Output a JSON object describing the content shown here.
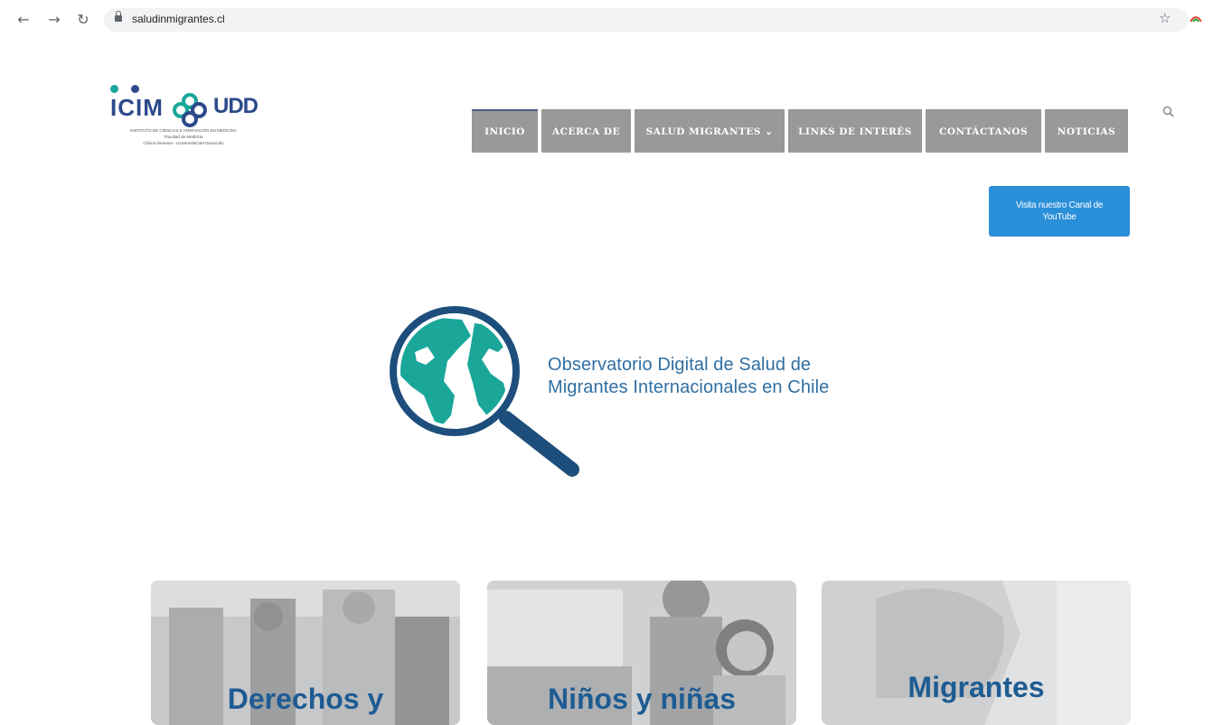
{
  "browser": {
    "url": "saludinmigrantes.cl",
    "back_icon": "arrow-left-icon",
    "forward_icon": "arrow-right-icon",
    "reload_icon": "reload-icon",
    "lock_icon": "lock-icon",
    "star_icon": "star-icon"
  },
  "logo": {
    "icim": "ICIM",
    "udd": "UDD",
    "sub_lines": [
      "INSTITUTO DE CIENCIAS E INNOVACIÓN EN MEDICINA",
      "Facultad de Medicina",
      "Clínica Alemana - Universidad del Desarrollo"
    ]
  },
  "nav": {
    "items": [
      {
        "label": "INICIO",
        "active": true
      },
      {
        "label": "ACERCA DE",
        "active": false
      },
      {
        "label": "SALUD MIGRANTES ⌄",
        "active": false
      },
      {
        "label": "LINKS DE INTERÉS",
        "active": false
      },
      {
        "label": "CONTÁCTANOS",
        "active": false
      },
      {
        "label": "NOTICIAS",
        "active": false
      }
    ],
    "search_icon": "search-icon"
  },
  "youtube_button": {
    "label": "Visita nuestro Canal de YouTube"
  },
  "hero": {
    "title_line1": "Observatorio Digital de Salud de",
    "title_line2": "Migrantes Internacionales en Chile",
    "icon": "magnifier-globe-icon"
  },
  "cards": [
    {
      "title": "Derechos y"
    },
    {
      "title": "Niños y niñas"
    },
    {
      "title": "Migrantes"
    }
  ],
  "colors": {
    "nav_bg": "#999999",
    "accent_blue": "#2a8fd9",
    "title_blue": "#2f6fa3",
    "card_title": "#1e5c93",
    "teal": "#1aa79a",
    "navy": "#1d4e7c"
  }
}
